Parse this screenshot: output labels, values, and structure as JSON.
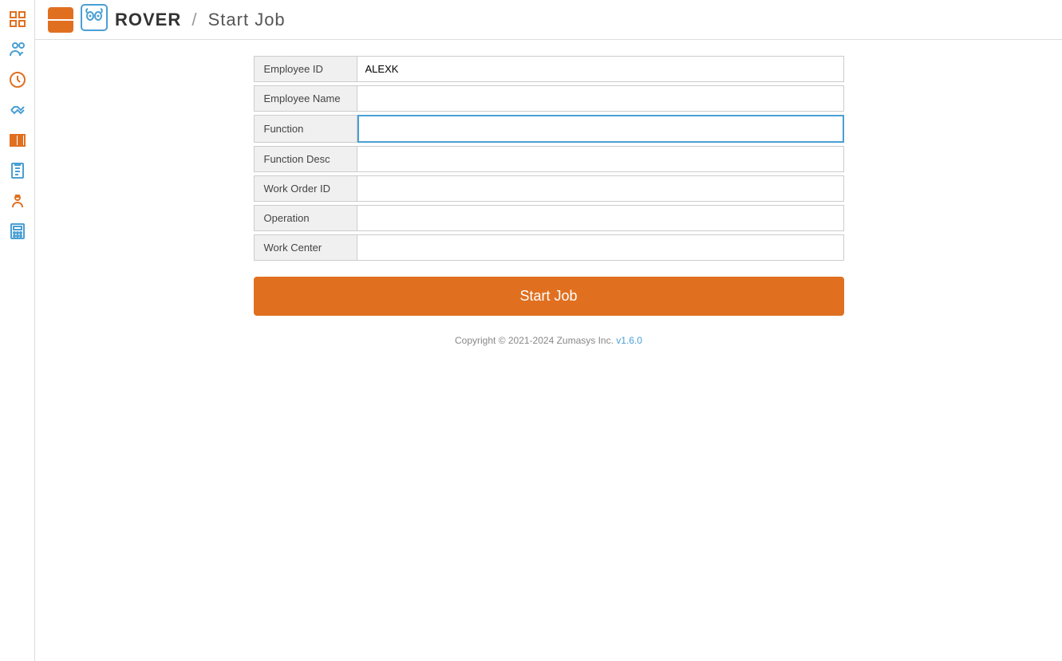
{
  "header": {
    "brand": "ROVER",
    "separator": "/",
    "page_title": "Start Job",
    "menu_button_label": "Menu"
  },
  "form": {
    "employee_id_label": "Employee ID",
    "employee_id_value": "ALEXK",
    "employee_name_label": "Employee Name",
    "employee_name_value": "",
    "function_label": "Function",
    "function_value": "",
    "function_desc_label": "Function Desc",
    "function_desc_value": "",
    "work_order_id_label": "Work Order ID",
    "work_order_id_value": "",
    "operation_label": "Operation",
    "operation_value": "",
    "work_center_label": "Work Center",
    "work_center_value": ""
  },
  "buttons": {
    "start_job": "Start Job"
  },
  "footer": {
    "copyright": "Copyright © 2021-2024 Zumasys Inc.",
    "version": "v1.6.0"
  },
  "sidebar": {
    "icons": [
      {
        "name": "grid-icon",
        "symbol": "⊞"
      },
      {
        "name": "people-icon",
        "symbol": "👥"
      },
      {
        "name": "clock-icon",
        "symbol": "⏱"
      },
      {
        "name": "handshake-icon",
        "symbol": "🤝"
      },
      {
        "name": "barcode-icon",
        "symbol": "▦"
      },
      {
        "name": "clipboard-icon",
        "symbol": "📋"
      },
      {
        "name": "engineer-icon",
        "symbol": "👷"
      },
      {
        "name": "calculator-icon",
        "symbol": "🖩"
      }
    ]
  }
}
